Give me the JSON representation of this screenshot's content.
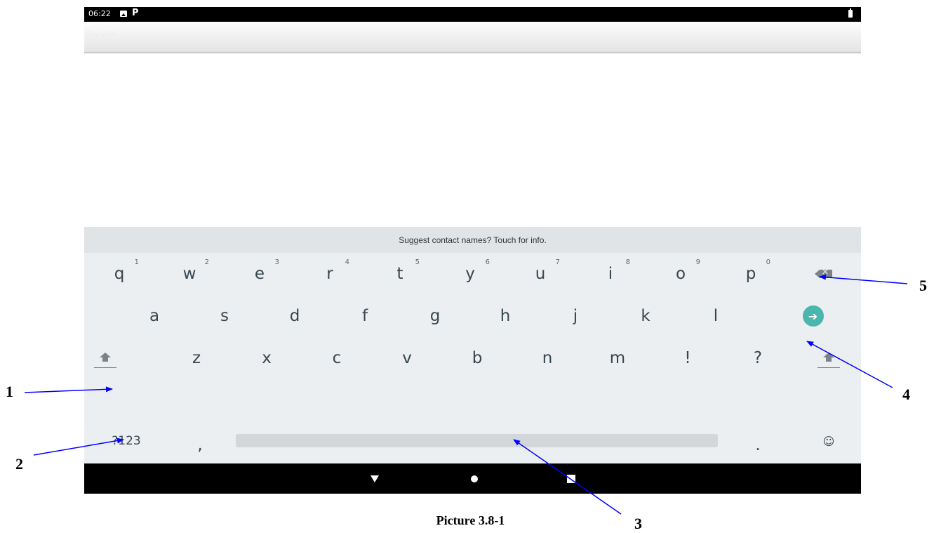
{
  "status_bar": {
    "time": "06:22",
    "icons": [
      "image-icon",
      "p-notification-icon",
      "battery-icon"
    ]
  },
  "app_bar": {
    "logo_text": "Google"
  },
  "keyboard": {
    "suggestion": "Suggest contact names? Touch for info.",
    "row1": [
      {
        "label": "q",
        "hint": "1"
      },
      {
        "label": "w",
        "hint": "2"
      },
      {
        "label": "e",
        "hint": "3"
      },
      {
        "label": "r",
        "hint": "4"
      },
      {
        "label": "t",
        "hint": "5"
      },
      {
        "label": "y",
        "hint": "6"
      },
      {
        "label": "u",
        "hint": "7"
      },
      {
        "label": "i",
        "hint": "8"
      },
      {
        "label": "o",
        "hint": "9"
      },
      {
        "label": "p",
        "hint": "0"
      }
    ],
    "row2": [
      "a",
      "s",
      "d",
      "f",
      "g",
      "h",
      "j",
      "k",
      "l"
    ],
    "row3": [
      "z",
      "x",
      "c",
      "v",
      "b",
      "n",
      "m",
      "!",
      "?"
    ],
    "row4": {
      "symbols_label": "?123",
      "comma": ",",
      "period": "."
    },
    "accent_color": "#4bb6ac"
  },
  "callouts": [
    "1",
    "2",
    "3",
    "4",
    "5"
  ],
  "caption": "Picture 3.8-1"
}
